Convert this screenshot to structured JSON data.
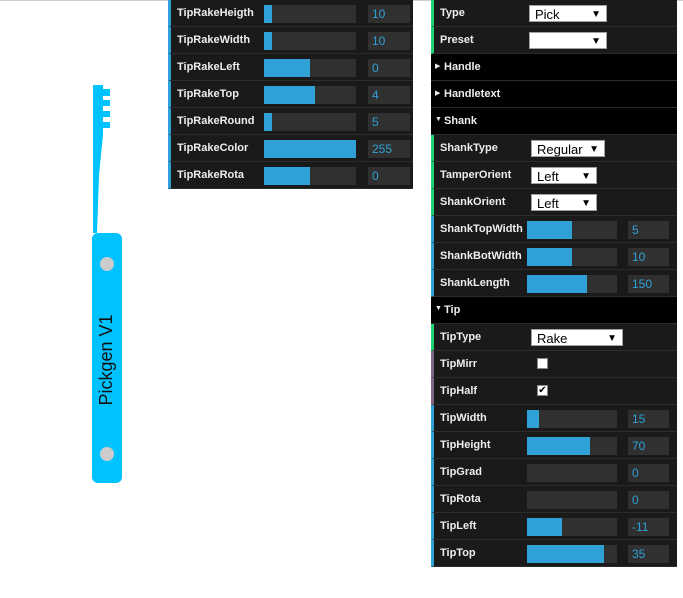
{
  "pick_label": "Pickgen V1",
  "colors": {
    "pick": "#00c2ff",
    "hole": "#cccccc",
    "slider": "#2fa1d6",
    "panel": "#1a1a1a"
  },
  "left_panel": {
    "rows": [
      {
        "label": "TipRakeHeigth",
        "value": "10",
        "fill": 0.09
      },
      {
        "label": "TipRakeWidth",
        "value": "10",
        "fill": 0.09
      },
      {
        "label": "TipRakeLeft",
        "value": "0",
        "fill": 0.5
      },
      {
        "label": "TipRakeTop",
        "value": "4",
        "fill": 0.55
      },
      {
        "label": "TipRakeRound",
        "value": "5",
        "fill": 0.09
      },
      {
        "label": "TipRakeColor",
        "value": "255",
        "fill": 1.0
      },
      {
        "label": "TipRakeRota",
        "value": "0",
        "fill": 0.5
      }
    ]
  },
  "right_panel": {
    "type": {
      "label": "Type",
      "value": "Pick"
    },
    "preset": {
      "label": "Preset",
      "value": ""
    },
    "folders": {
      "handle": "Handle",
      "handletext": "Handletext",
      "shank": "Shank",
      "tip": "Tip"
    },
    "shank": {
      "shanktype": {
        "label": "ShankType",
        "value": "Regular"
      },
      "tamperorient": {
        "label": "TamperOrient",
        "value": "Left"
      },
      "shankorient": {
        "label": "ShankOrient",
        "value": "Left"
      },
      "shanktopwidth": {
        "label": "ShankTopWidth",
        "value": "5",
        "fill": 0.5
      },
      "shankbotwidth": {
        "label": "ShankBotWidth",
        "value": "10",
        "fill": 0.5
      },
      "shanklength": {
        "label": "ShankLength",
        "value": "150",
        "fill": 0.67
      }
    },
    "tip": {
      "tiptype": {
        "label": "TipType",
        "value": "Rake"
      },
      "tipmirr": {
        "label": "TipMirr",
        "checked": false
      },
      "tiphalf": {
        "label": "TipHalf",
        "checked": true,
        "mark": "✔"
      },
      "tipwidth": {
        "label": "TipWidth",
        "value": "15",
        "fill": 0.13
      },
      "tipheight": {
        "label": "TipHeight",
        "value": "70",
        "fill": 0.7
      },
      "tipgrad": {
        "label": "TipGrad",
        "value": "0",
        "fill": 0.0
      },
      "tiprota": {
        "label": "TipRota",
        "value": "0",
        "fill": 0.0
      },
      "tipleft": {
        "label": "TipLeft",
        "value": "-11",
        "fill": 0.39
      },
      "tiptop": {
        "label": "TipTop",
        "value": "35",
        "fill": 0.86
      }
    }
  }
}
